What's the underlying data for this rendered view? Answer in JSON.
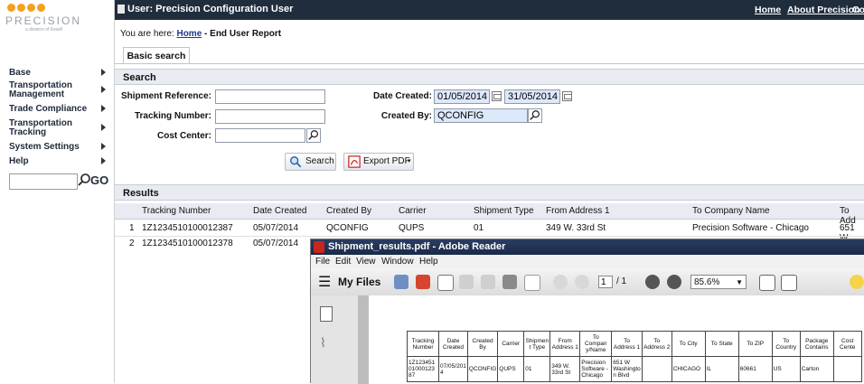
{
  "logo": {
    "text": "PRECISION",
    "sub": "a division of Kewill"
  },
  "sidebar": {
    "items": [
      {
        "label": "Base"
      },
      {
        "label": "Transportation Management"
      },
      {
        "label": "Trade Compliance"
      },
      {
        "label": "Transportation Tracking"
      },
      {
        "label": "System Settings"
      },
      {
        "label": "Help"
      }
    ],
    "search_value": "",
    "go_label": "GO"
  },
  "header": {
    "title": "User: Precision Configuration User",
    "links": [
      "Home",
      "About Precision",
      "Co"
    ]
  },
  "breadcrumb": {
    "prefix": "You are here: ",
    "home": "Home",
    "suffix": " - End User Report"
  },
  "tabs": [
    {
      "label": "Basic search"
    }
  ],
  "search": {
    "title": "Search",
    "shipment_reference": {
      "label": "Shipment Reference:",
      "value": ""
    },
    "tracking_number": {
      "label": "Tracking Number:",
      "value": ""
    },
    "cost_center": {
      "label": "Cost Center:",
      "value": ""
    },
    "date_created": {
      "label": "Date Created:",
      "from": "01/05/2014",
      "to": "31/05/2014"
    },
    "created_by": {
      "label": "Created By:",
      "value": "QCONFIG"
    },
    "search_button": "Search",
    "export_button": "Export PDF"
  },
  "results": {
    "title": "Results",
    "columns": [
      "Tracking Number",
      "Date Created",
      "Created By",
      "Carrier",
      "Shipment Type",
      "From Address 1",
      "To Company Name",
      "To Add"
    ],
    "rows": [
      {
        "num": "1",
        "cells": [
          "1Z1234510100012387",
          "05/07/2014",
          "QCONFIG",
          "QUPS",
          "01",
          "349 W. 33rd St",
          "Precision Software - Chicago",
          "651 W"
        ]
      },
      {
        "num": "2",
        "cells": [
          "1Z1234510100012378",
          "05/07/2014",
          "",
          "",
          "",
          "",
          "",
          ""
        ]
      }
    ]
  },
  "reader": {
    "title": "Shipment_results.pdf - Adobe Reader",
    "menu": [
      "File",
      "Edit",
      "View",
      "Window",
      "Help"
    ],
    "my_files": "My Files",
    "page_current": "1",
    "page_total": "/ 1",
    "zoom": "85.6%",
    "pdf_table": {
      "headers": [
        "Tracking Number",
        "Date Created",
        "Created By",
        "Carrier",
        "Shipmen t Type",
        "From Address 1",
        "To Compan y/Name",
        "To Address 1",
        "To Address 2",
        "To City",
        "To State",
        "To ZIP",
        "To Country",
        "Package Contains",
        "Cost Cente"
      ],
      "row": [
        "1Z123451 01000123 87",
        "07/05/201 4",
        "QCONFIG",
        "QUPS",
        "01",
        "349 W. 33rd St",
        "Precision Software - Chicago",
        "651 W Washingto n Blvd",
        "",
        "CHICAGO",
        "IL",
        "60661",
        "US",
        "Carton",
        ""
      ]
    }
  },
  "colors": {
    "header_bg": "#1f2d3d",
    "logo_orange": "#f1a11f",
    "section_bg": "#e8ecf2"
  }
}
